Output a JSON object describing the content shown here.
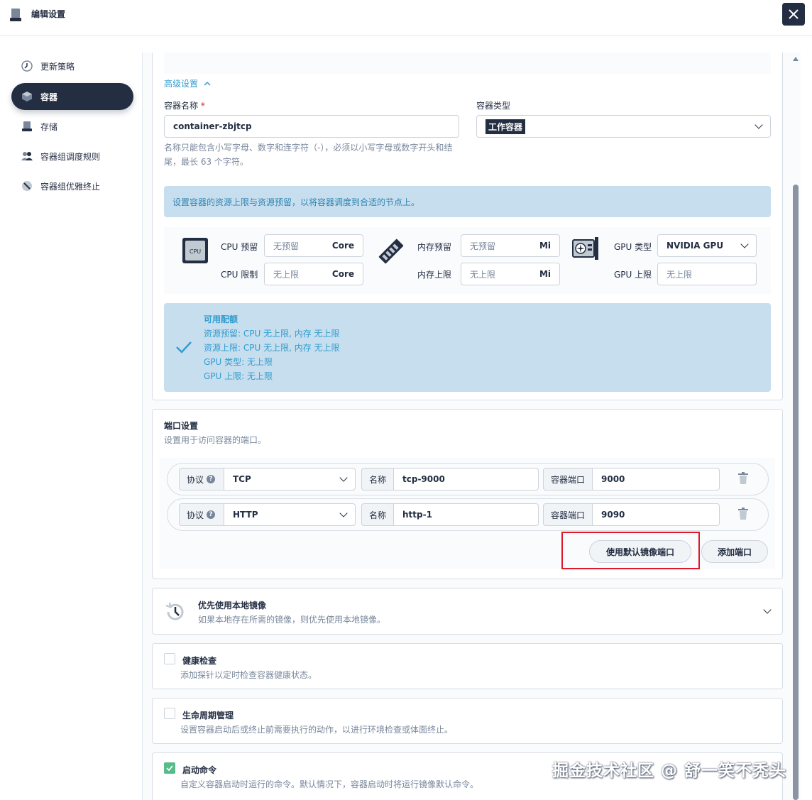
{
  "header": {
    "title": "编辑设置"
  },
  "sidebar": {
    "items": [
      {
        "label": "更新策略",
        "icon": "update-strategy-icon"
      },
      {
        "label": "容器",
        "icon": "container-icon",
        "active": true
      },
      {
        "label": "存储",
        "icon": "storage-icon"
      },
      {
        "label": "容器组调度规则",
        "icon": "scheduling-icon"
      },
      {
        "label": "容器组优雅终止",
        "icon": "terminate-icon"
      }
    ]
  },
  "container": {
    "advanced_label": "高级设置",
    "name_label": "容器名称",
    "name_required": "*",
    "name_value": "container-zbjtcp",
    "name_hint_1": "名称只能包含小写字母、数字和连字符（-），必须以小写字母或数字开头和结",
    "name_hint_2": "尾，最长 63 个字符。",
    "type_label": "容器类型",
    "type_value": "工作容器",
    "resource_info": "设置容器的资源上限与资源预留，以将容器调度到合适的节点上。",
    "cpu_chip_text": "CPU",
    "cpu_reserve_label": "CPU 预留",
    "cpu_reserve_placeholder": "无预留",
    "cpu_limit_label": "CPU 限制",
    "cpu_limit_placeholder": "无上限",
    "cpu_unit": "Core",
    "mem_reserve_label": "内存预留",
    "mem_reserve_placeholder": "无预留",
    "mem_limit_label": "内存上限",
    "mem_limit_placeholder": "无上限",
    "mem_unit": "Mi",
    "gpu_type_label": "GPU 类型",
    "gpu_type_value": "NVIDIA GPU",
    "gpu_limit_label": "GPU 上限",
    "gpu_limit_placeholder": "无上限",
    "quota": {
      "title": "可用配额",
      "lines": [
        "资源预留:  CPU 无上限, 内存 无上限",
        "资源上限:  CPU 无上限, 内存 无上限",
        "GPU 类型:  无上限",
        "GPU 上限:  无上限"
      ]
    }
  },
  "ports": {
    "title": "端口设置",
    "desc": "设置用于访问容器的端口。",
    "protocol_label": "协议",
    "name_label": "名称",
    "port_label": "容器端口",
    "rows": [
      {
        "protocol": "TCP",
        "name": "tcp-9000",
        "port": "9000"
      },
      {
        "protocol": "HTTP",
        "name": "http-1",
        "port": "9090"
      }
    ],
    "default_btn": "使用默认镜像端口",
    "add_btn": "添加端口"
  },
  "local_image": {
    "title": "优先使用本地镜像",
    "desc": "如果本地存在所需的镜像，则优先使用本地镜像。"
  },
  "health": {
    "title": "健康检查",
    "desc": "添加探针以定时检查容器健康状态。"
  },
  "lifecycle": {
    "title": "生命周期管理",
    "desc": "设置容器启动后或终止前需要执行的动作，以进行环境检查或体面终止。"
  },
  "start_cmd": {
    "title": "启动命令",
    "desc": "自定义容器启动时运行的命令。默认情况下，容器启动时将运行镜像默认命令。",
    "checked": true
  },
  "watermark": "掘金技术社区 @ 舒一笑不秃头",
  "colors": {
    "primary_dark": "#242e42",
    "info_bg": "#c7deef",
    "info_text": "#329dce",
    "success": "#55bc8a",
    "highlight": "#e0182a"
  }
}
